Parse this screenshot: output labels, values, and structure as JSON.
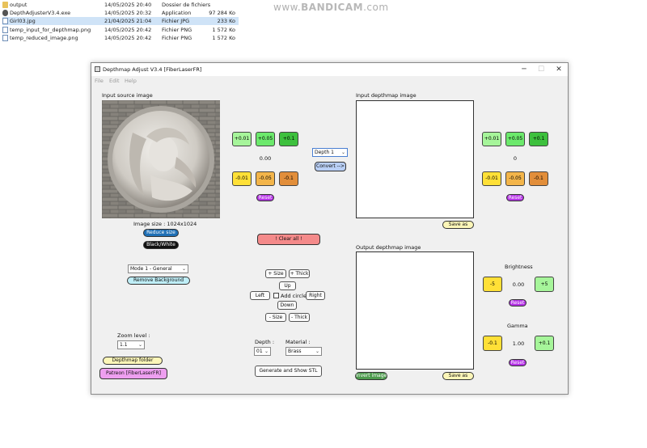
{
  "file_list": [
    {
      "name": "output",
      "date": "14/05/2025 20:40",
      "type": "Dossier de fichiers",
      "size": "",
      "icon": "folder-icon"
    },
    {
      "name": "DepthAdjusterV3.4.exe",
      "date": "14/05/2025 20:32",
      "type": "Application",
      "size": "97 284 Ko",
      "icon": "exe-icon"
    },
    {
      "name": "Girl03.jpg",
      "date": "21/04/2025 21:04",
      "type": "Fichier JPG",
      "size": "233 Ko",
      "icon": "image-file-icon",
      "selected": true
    },
    {
      "name": "temp_input_for_depthmap.png",
      "date": "14/05/2025 20:42",
      "type": "Fichier PNG",
      "size": "1 572 Ko",
      "icon": "image-file-icon"
    },
    {
      "name": "temp_reduced_image.png",
      "date": "14/05/2025 20:42",
      "type": "Fichier PNG",
      "size": "1 572 Ko",
      "icon": "image-file-icon"
    }
  ],
  "watermark": {
    "prefix": "www.",
    "brand": "BANDICAM",
    "suffix": ".com"
  },
  "window": {
    "title": "Depthmap Adjust V3.4 [FiberLaserFR]",
    "controls": {
      "minimize": "─",
      "maximize": "☐",
      "close": "✕"
    }
  },
  "menu": [
    "File",
    "Edit",
    "Help"
  ],
  "input_source": {
    "label": "Input source image",
    "image_size": "Image size : 1024x1024",
    "reduce_size": "Reduce size",
    "black_white": "Black/White",
    "mode_select": "Mode 1 - General",
    "remove_background": "Remove Background",
    "zoom_label": "Zoom level :",
    "zoom_value": "1.1",
    "depthmap_folder": "Depthmap folder",
    "patreon": "Patreon [FiberLaserFR]"
  },
  "left_adjust": {
    "plus": [
      "+0.01",
      "+0.05",
      "+0.1"
    ],
    "value": "0.00",
    "minus": [
      "-0.01",
      "-0.05",
      "-0.1"
    ],
    "reset": "Reset"
  },
  "depth_select": "Depth 1",
  "convert": "Convert -->",
  "clear_all": "!   Clear all   !",
  "shape": {
    "plus_size": "+ Size",
    "plus_thick": "+ Thick",
    "up": "Up",
    "left": "Left",
    "add_circle": "Add circle",
    "right": "Right",
    "down": "Down",
    "minus_size": "- Size",
    "minus_thick": "- Thick"
  },
  "depth_label": "Depth :",
  "depth_value": "01",
  "material_label": "Material :",
  "material_value": "Brass",
  "generate_stl": "Generate and Show STL",
  "input_depthmap": {
    "label": "Input depthmap image",
    "save": "Save as"
  },
  "output_depthmap": {
    "label": "Output depthmap image",
    "invert": "Invert image",
    "save": "Save as"
  },
  "right_adjust": {
    "plus": [
      "+0.01",
      "+0.05",
      "+0.1"
    ],
    "value": "0",
    "minus": [
      "-0.01",
      "-0.05",
      "-0.1"
    ],
    "reset": "Reset"
  },
  "brightness": {
    "label": "Brightness",
    "minus": "-5",
    "value": "0.00",
    "plus": "+5",
    "reset": "Reset"
  },
  "gamma": {
    "label": "Gamma",
    "minus": "-0.1",
    "value": "1.00",
    "plus": "+0.1",
    "reset": "Reset"
  },
  "colors": {
    "reset_purple": "#b533e6",
    "reduce_blue": "#1e6fb5",
    "clear_red": "#f48a8a",
    "patreon_pink": "#ee9ff0",
    "remove_bg_cyan": "#bfeef7",
    "folder_yellow": "#fcf6b8",
    "convert_blue": "#b9cff5",
    "invert_green": "#4e9b4e"
  }
}
